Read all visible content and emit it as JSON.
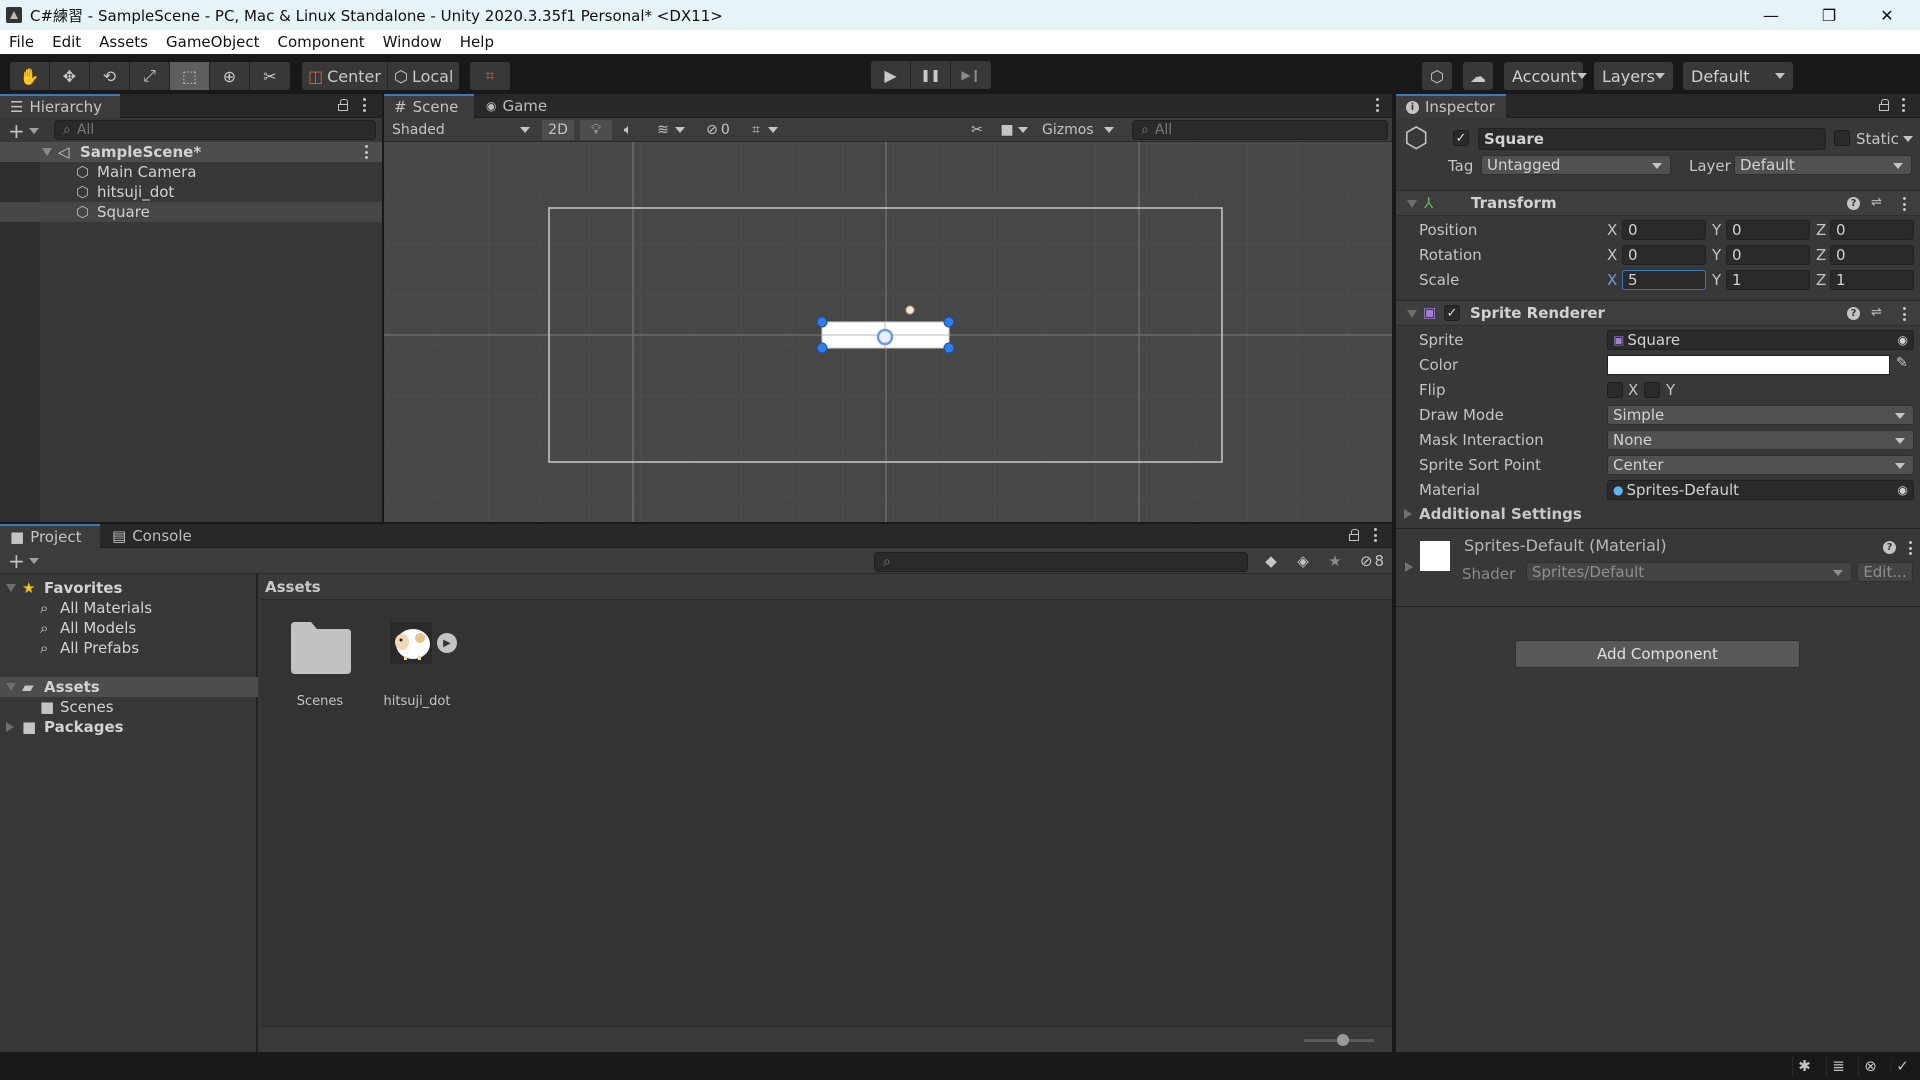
{
  "window": {
    "title": "C#練習 - SampleScene - PC, Mac & Linux Standalone - Unity 2020.3.35f1 Personal* <DX11>",
    "controls": {
      "minimize": "—",
      "maximize": "❐",
      "close": "✕"
    }
  },
  "menu": [
    "File",
    "Edit",
    "Assets",
    "GameObject",
    "Component",
    "Window",
    "Help"
  ],
  "toolbar": {
    "tools": [
      {
        "name": "hand-tool",
        "glyph": "✋",
        "active": false
      },
      {
        "name": "move-tool",
        "glyph": "✥",
        "active": false
      },
      {
        "name": "rotate-tool",
        "glyph": "⟲",
        "active": false
      },
      {
        "name": "scale-tool",
        "glyph": "⤢",
        "active": false
      },
      {
        "name": "rect-tool",
        "glyph": "⬚",
        "active": true
      },
      {
        "name": "transform-tool",
        "glyph": "⊕",
        "active": false
      },
      {
        "name": "custom-tool",
        "glyph": "✂",
        "active": false
      }
    ],
    "pivot_label": "Center",
    "space_label": "Local",
    "snap_glyph": "⌗",
    "play_glyph": "▶",
    "pause_glyph": "❚❚",
    "step_glyph": "▶❙",
    "collab_glyph": "⬡",
    "cloud_glyph": "☁",
    "account_label": "Account",
    "layers_label": "Layers",
    "layout_label": "Default"
  },
  "hierarchy": {
    "tab_label": "Hierarchy",
    "search_placeholder": "All",
    "scene_name": "SampleScene*",
    "items": [
      {
        "label": "Main Camera",
        "selected": false
      },
      {
        "label": "hitsuji_dot",
        "selected": false
      },
      {
        "label": "Square",
        "selected": true
      }
    ]
  },
  "scene": {
    "tabs": [
      {
        "label": "Scene",
        "glyph": "#",
        "active": true
      },
      {
        "label": "Game",
        "glyph": "🎮",
        "active": false
      }
    ],
    "shading_mode": "Shaded",
    "mode_2d_label": "2D",
    "hidden_count": "0",
    "gizmos_label": "Gizmos",
    "search_placeholder": "All"
  },
  "inspector": {
    "tab_label": "Inspector",
    "object_name": "Square",
    "active": true,
    "static_label": "Static",
    "tag_label": "Tag",
    "tag_value": "Untagged",
    "layer_label": "Layer",
    "layer_value": "Default",
    "transform": {
      "title": "Transform",
      "rows": [
        {
          "label": "Position",
          "x": "0",
          "y": "0",
          "z": "0"
        },
        {
          "label": "Rotation",
          "x": "0",
          "y": "0",
          "z": "0"
        },
        {
          "label": "Scale",
          "x": "5",
          "y": "1",
          "z": "1"
        }
      ],
      "axis_labels": [
        "X",
        "Y",
        "Z"
      ]
    },
    "sprite_renderer": {
      "title": "Sprite Renderer",
      "enabled": true,
      "sprite_label": "Sprite",
      "sprite_value": "Square",
      "color_label": "Color",
      "color_value": "#ffffff",
      "flip_label": "Flip",
      "flip_x_label": "X",
      "flip_y_label": "Y",
      "draw_mode_label": "Draw Mode",
      "draw_mode_value": "Simple",
      "mask_label": "Mask Interaction",
      "mask_value": "None",
      "sort_point_label": "Sprite Sort Point",
      "sort_point_value": "Center",
      "material_label": "Material",
      "material_value": "Sprites-Default",
      "additional_settings_label": "Additional Settings"
    },
    "material": {
      "title": "Sprites-Default (Material)",
      "shader_label": "Shader",
      "shader_value": "Sprites/Default",
      "edit_label": "Edit..."
    },
    "add_component_label": "Add Component"
  },
  "project": {
    "tabs": [
      {
        "label": "Project",
        "active": true
      },
      {
        "label": "Console",
        "active": false
      }
    ],
    "hidden_packages_count": "8",
    "tree": {
      "favorites_label": "Favorites",
      "favorites": [
        "All Materials",
        "All Models",
        "All Prefabs"
      ],
      "assets_label": "Assets",
      "assets_children": [
        "Scenes"
      ],
      "packages_label": "Packages"
    },
    "breadcrumb": "Assets",
    "assets": [
      {
        "name": "Scenes",
        "type": "folder"
      },
      {
        "name": "hitsuji_dot",
        "type": "sprite"
      }
    ],
    "zoom_level": 0.55
  },
  "colors": {
    "accent_blue": "#3a79bb",
    "selection": "#4d4d4d",
    "panel": "#383838",
    "toolbar": "#191919",
    "orange": "#e0602d"
  }
}
